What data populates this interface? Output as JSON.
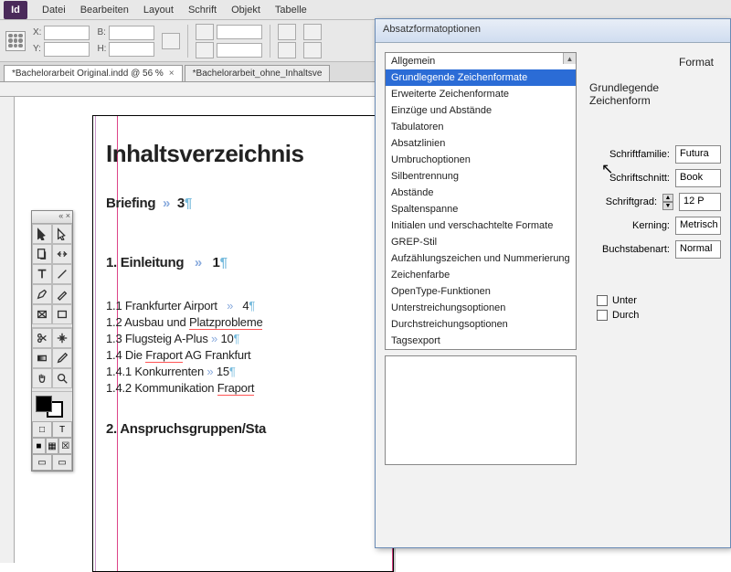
{
  "app": {
    "logo": "Id"
  },
  "menus": [
    "Datei",
    "Bearbeiten",
    "Layout",
    "Schrift",
    "Objekt",
    "Tabelle"
  ],
  "controls": {
    "x_label": "X:",
    "y_label": "Y:",
    "w_label": "B:",
    "h_label": "H:"
  },
  "tabs": [
    {
      "label": "*Bachelorarbeit Original.indd @ 56 %",
      "active": true
    },
    {
      "label": "*Bachelorarbeit_ohne_Inhaltsve",
      "active": false
    }
  ],
  "document": {
    "title": "Inhaltsverzeichnis",
    "sections": [
      {
        "label": "Briefing",
        "page": "3"
      },
      {
        "label": "1. Einleitung",
        "page": "1"
      },
      {
        "label": "2. Anspruchsgruppen/Sta",
        "page": ""
      }
    ],
    "entries": [
      {
        "label": "1.1 Frankfurter Airport",
        "page": "4"
      },
      {
        "label": "1.2 Ausbau und Platzprobleme",
        "page": "",
        "ul": "Platzprobleme"
      },
      {
        "label": "1.3 Flugsteig A-Plus",
        "page": "10"
      },
      {
        "label": "1.4 Die Fraport AG Frankfurt",
        "page": "",
        "ul": "Fraport"
      },
      {
        "label": "1.4.1 Konkurrenten",
        "page": "15"
      },
      {
        "label": "1.4.2 Kommunikation Fraport",
        "page": "",
        "ul": "Fraport"
      }
    ]
  },
  "dialog": {
    "title": "Absatzformatoptionen",
    "sidebar_format": "Format",
    "heading": "Grundlegende Zeichenform",
    "categories": [
      "Allgemein",
      "Grundlegende Zeichenformate",
      "Erweiterte Zeichenformate",
      "Einzüge und Abstände",
      "Tabulatoren",
      "Absatzlinien",
      "Umbruchoptionen",
      "Silbentrennung",
      "Abstände",
      "Spaltenspanne",
      "Initialen und verschachtelte Formate",
      "GREP-Stil",
      "Aufzählungszeichen und Nummerierung",
      "Zeichenfarbe",
      "OpenType-Funktionen",
      "Unterstreichungsoptionen",
      "Durchstreichungsoptionen",
      "Tagsexport"
    ],
    "selected_category_idx": 1,
    "fields": {
      "family_label": "Schriftfamilie:",
      "family_value": "Futura",
      "style_label": "Schriftschnitt:",
      "style_value": "Book",
      "size_label": "Schriftgrad:",
      "size_value": "12 P",
      "kerning_label": "Kerning:",
      "kerning_value": "Metrisch",
      "case_label": "Buchstabenart:",
      "case_value": "Normal"
    },
    "checks": {
      "underline": "Unter",
      "strike": "Durch"
    }
  }
}
